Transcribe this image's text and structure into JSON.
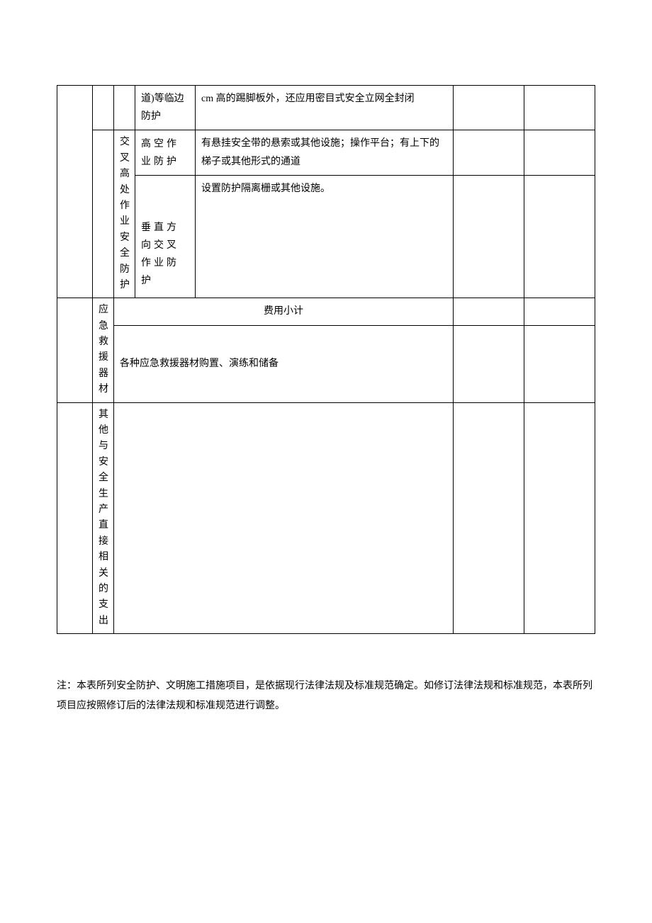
{
  "table": {
    "rows": [
      {
        "col4": "道)等临边防护",
        "col5": "cm 高的踢脚板外，还应用密目式安全立网全封闭"
      },
      {
        "col3": "交叉高处作业安全防护",
        "col4": "高空作业防护",
        "col5": "有悬挂安全带的悬索或其他设施；操作平台；有上下的梯子或其他形式的通道"
      },
      {
        "col4": "垂直方向交叉作业防护",
        "col5": "设置防护隔离栅或其他设施。"
      },
      {
        "col2": "应急救援器材",
        "subtotal": "费用小计",
        "content": "各种应急救援器材购置、演练和储备"
      },
      {
        "col2": "其他与安全生产直接相关的支出"
      }
    ]
  },
  "note": "注：本表所列安全防护、文明施工措施项目，是依据现行法律法规及标准规范确定。如修订法律法规和标准规范，本表所列项目应按照修订后的法律法规和标准规范进行调整。"
}
